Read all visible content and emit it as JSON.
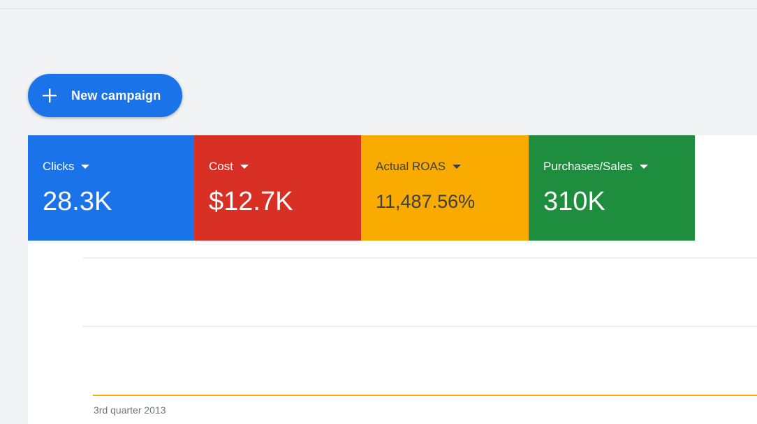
{
  "new_campaign_button": {
    "label": "New campaign"
  },
  "scorecards": [
    {
      "metric": "Clicks",
      "value": "28.3K",
      "color": "#1a73e8",
      "text_color": "#ffffff"
    },
    {
      "metric": "Cost",
      "value": "$12.7K",
      "color": "#d93025",
      "text_color": "#ffffff"
    },
    {
      "metric": "Actual ROAS",
      "value": "11,487.56%",
      "color": "#f9ab00",
      "text_color": "#3c4043"
    },
    {
      "metric": "Purchases/Sales",
      "value": "310K",
      "color": "#1e8e3e",
      "text_color": "#ffffff"
    }
  ],
  "chart": {
    "x_tick_label": "3rd quarter 2013",
    "line_color": "#f9ab00",
    "gridline_color": "#e0e0e0"
  }
}
